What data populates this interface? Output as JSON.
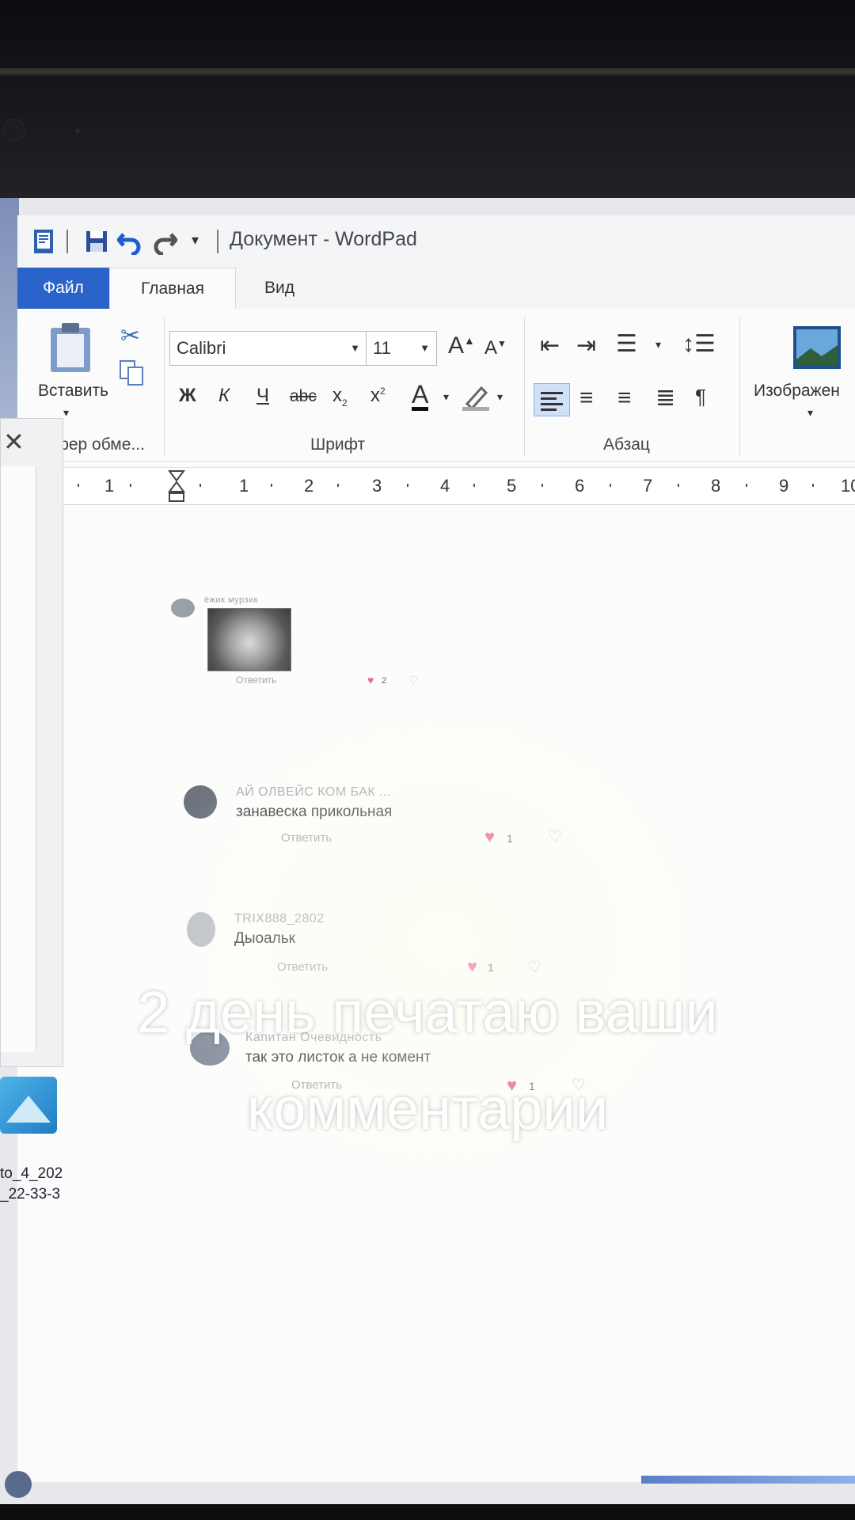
{
  "app": {
    "title": "Документ - WordPad"
  },
  "tabs": [
    {
      "label": "Файл"
    },
    {
      "label": "Главная"
    },
    {
      "label": "Вид"
    }
  ],
  "ribbon": {
    "clipboard": {
      "paste_label": "Вставить",
      "group_label": "Буфер обме..."
    },
    "font": {
      "family": "Calibri",
      "size": "11",
      "group_label": "Шрифт",
      "bold": "Ж",
      "italic": "К",
      "underline": "Ч",
      "strike": "abc"
    },
    "paragraph": {
      "group_label": "Абзац"
    },
    "insert": {
      "image_label": "Изображен"
    }
  },
  "ruler": {
    "numbers": [
      "1",
      "1",
      "2",
      "3",
      "4",
      "5",
      "6",
      "7",
      "8",
      "9",
      "10"
    ]
  },
  "comments": [
    {
      "user": "ёжик мурзик",
      "text": "",
      "reply": "Ответить",
      "likes": "2"
    },
    {
      "user": "АЙ ОЛВЕЙС КОМ БАК ...",
      "text": "занавеска прикольная",
      "reply": "Ответить",
      "likes": "1"
    },
    {
      "user": "TRIX888_2802",
      "text": "Дыоальк",
      "reply": "Ответить",
      "likes": "1"
    },
    {
      "user": "Капитан Очевидность",
      "text": "так это листок а не комент",
      "reply": "Ответить",
      "likes": "1"
    }
  ],
  "desktop": {
    "file_label_1": "to_4_202",
    "file_label_2": "_22-33-3"
  },
  "overlay": {
    "line1": "2 день печатаю ваши",
    "line2": "комментарии"
  },
  "colors": {
    "file_tab": "#2a63c9",
    "heart": "#e6559a",
    "caption": "#ffffff"
  }
}
